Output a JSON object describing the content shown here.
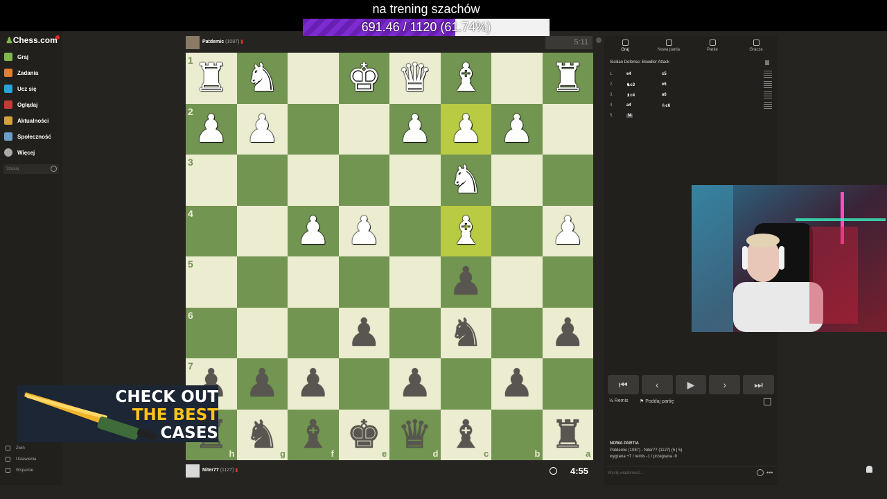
{
  "stream": {
    "goal_title": "na trening szachów",
    "goal_progress_text": "691.46 / 1120 (61.74%)",
    "goal_progress": 0.6174
  },
  "sidebar": {
    "logo": "Chess.com",
    "items": [
      {
        "label": "Graj",
        "icon": "pawn-icon",
        "color": "#81b64c"
      },
      {
        "label": "Zadania",
        "icon": "puzzle-icon",
        "color": "#e37f31"
      },
      {
        "label": "Ucz się",
        "icon": "graduation-icon",
        "color": "#29a3d9"
      },
      {
        "label": "Oglądaj",
        "icon": "binoculars-icon",
        "color": "#c23b36"
      },
      {
        "label": "Aktualności",
        "icon": "news-icon",
        "color": "#d4a13a"
      },
      {
        "label": "Społeczność",
        "icon": "community-icon",
        "color": "#6d9fcb"
      },
      {
        "label": "Więcej",
        "icon": "more-icon",
        "color": "#aaaaaa"
      }
    ],
    "search_placeholder": "Szukaj",
    "bottom": [
      "Zwiń",
      "Ustawienia",
      "Wsparcie"
    ]
  },
  "top_player": {
    "name": "Patdemic",
    "rating": "(1087)",
    "clock": "5:11"
  },
  "bottom_player": {
    "name": "Niter77",
    "rating": "(1127)",
    "clock": "4:55"
  },
  "board": {
    "ranks": [
      "1",
      "2",
      "3",
      "4",
      "5",
      "6",
      "7"
    ],
    "files": [
      "h",
      "g",
      "f",
      "e",
      "d",
      "c",
      "b",
      "a"
    ],
    "highlight_squares": [
      "c2",
      "c4"
    ]
  },
  "right_panel": {
    "tabs": [
      {
        "label": "Graj",
        "icon": "lightning-icon"
      },
      {
        "label": "Nowa partia",
        "icon": "plus-icon"
      },
      {
        "label": "Partie",
        "icon": "grid-icon"
      },
      {
        "label": "Gracze",
        "icon": "players-icon"
      }
    ],
    "opening": "Sicilian Defense: Bowdler Attack",
    "moves": [
      {
        "num": "1.",
        "white": "e4",
        "black": "c5"
      },
      {
        "num": "2.",
        "white": "♞c3",
        "black": "e6"
      },
      {
        "num": "3.",
        "white": "♝c4",
        "black": "a6"
      },
      {
        "num": "4.",
        "white": "a4",
        "black": "♘c6"
      },
      {
        "num": "5.",
        "white": "f4",
        "black": ""
      }
    ],
    "draw_label": "Remis",
    "resign_label": "Poddaj partię",
    "new_game_title": "NOWA PARTIA",
    "new_game_line1": "Patdemic (1087) - Niter77 (1127) (5 | 5)",
    "new_game_line2": "wygrana +7 / remis -1 / przegrana -9",
    "chat_placeholder": "Wyślij wiadomość..."
  },
  "promo": {
    "line1": "CHECK OUT",
    "line2": "THE BEST",
    "line3": "CASES"
  }
}
